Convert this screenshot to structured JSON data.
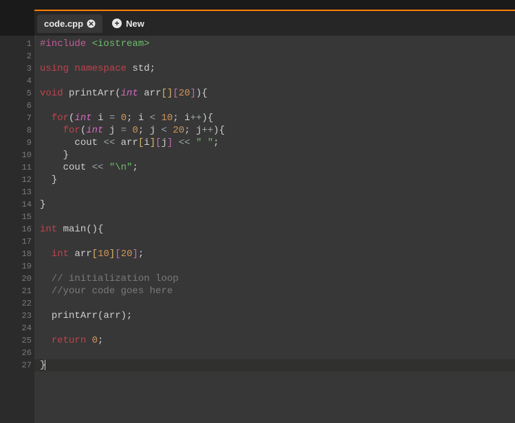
{
  "tabs": {
    "active": {
      "label": "code.cpp"
    },
    "new": {
      "label": "New"
    }
  },
  "gutter": {
    "lines": [
      "1",
      "2",
      "3",
      "4",
      "5",
      "6",
      "7",
      "8",
      "9",
      "10",
      "11",
      "12",
      "13",
      "14",
      "15",
      "16",
      "17",
      "18",
      "19",
      "20",
      "21",
      "22",
      "23",
      "24",
      "25",
      "26",
      "27"
    ],
    "foldable": [
      5,
      7,
      8,
      16
    ]
  },
  "code": {
    "l1_include": "#include",
    "l1_header": "<iostream>",
    "l3_using": "using",
    "l3_namespace": "namespace",
    "l3_std": "std",
    "l5_void": "void",
    "l5_fn": "printArr",
    "l5_int": "int",
    "l5_arr": "arr",
    "l5_20": "20",
    "l7_for": "for",
    "l7_int": "int",
    "l7_i": "i",
    "l7_0": "0",
    "l7_10": "10",
    "l8_for": "for",
    "l8_int": "int",
    "l8_j": "j",
    "l8_0": "0",
    "l8_20": "20",
    "l9_cout": "cout",
    "l9_arr": "arr",
    "l9_i": "i",
    "l9_j": "j",
    "l9_space": "\" \"",
    "l11_cout": "cout",
    "l11_nl": "\"\\n\"",
    "l16_int": "int",
    "l16_main": "main",
    "l18_int": "int",
    "l18_arr": "arr",
    "l18_10": "10",
    "l18_20": "20",
    "l20_comment": "// initialization loop",
    "l21_comment": "//your code goes here",
    "l23_fn": "printArr",
    "l23_arr": "arr",
    "l25_return": "return",
    "l25_0": "0"
  }
}
